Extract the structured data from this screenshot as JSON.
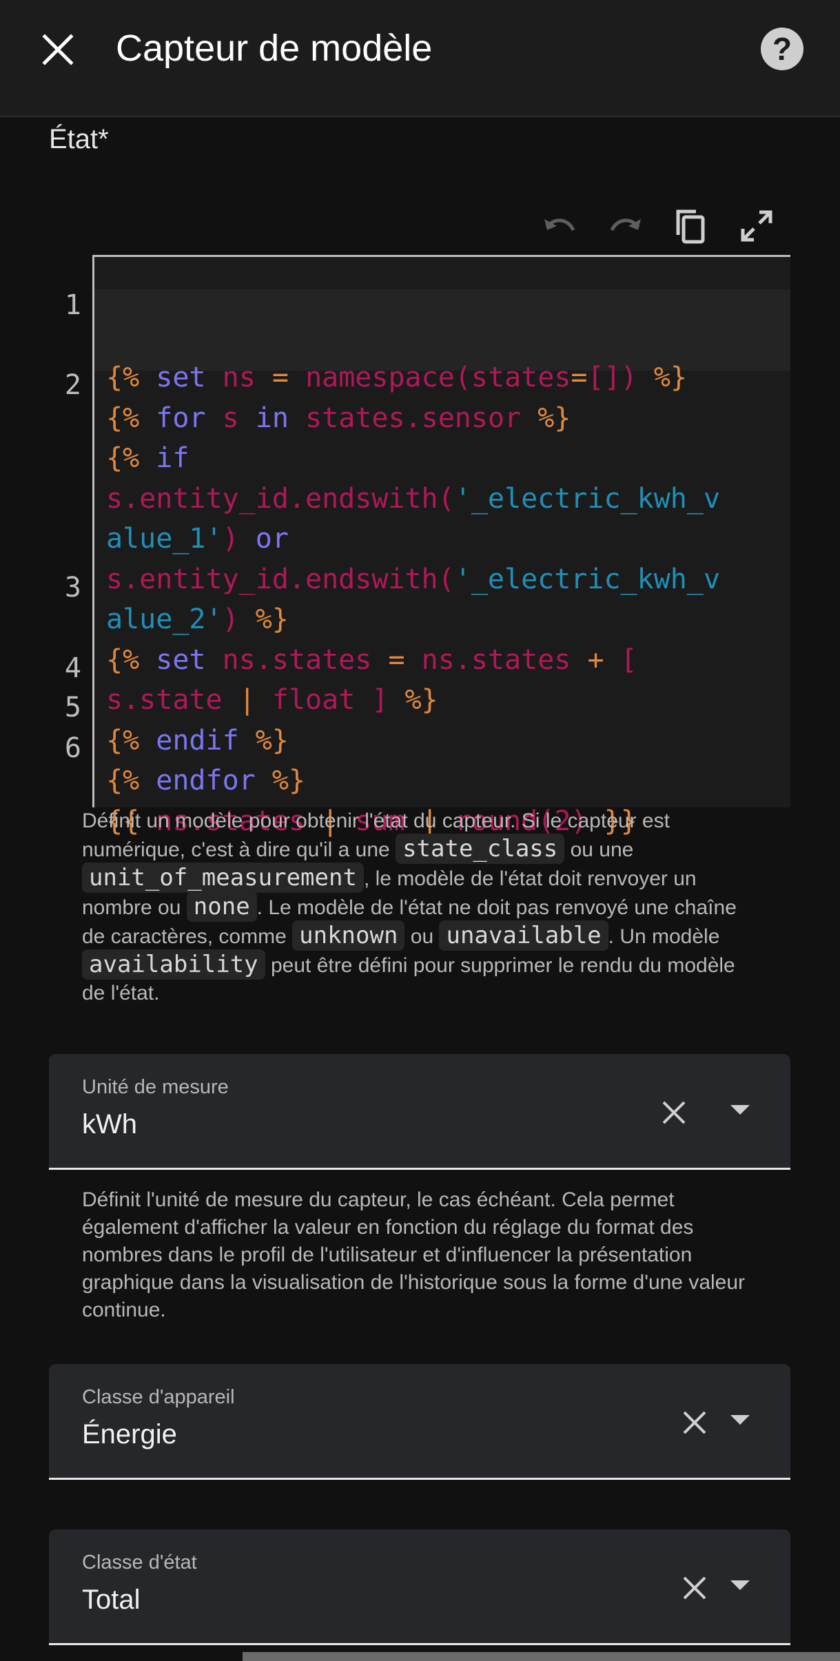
{
  "header": {
    "title": "Capteur de modèle"
  },
  "state_field": {
    "label": "État*"
  },
  "code_editor": {
    "line_numbers": [
      "1",
      "2",
      "3",
      "4",
      "5",
      "6"
    ],
    "lines": [
      "{% set ns = namespace(states=[]) %}",
      "{% for s in states.sensor %}",
      "{% if",
      "s.entity_id.endswith('_electric_kwh_v",
      "alue_1') or",
      "s.entity_id.endswith('_electric_kwh_v",
      "alue_2') %}",
      "{% set ns.states = ns.states + [",
      "s.state | float ] %}",
      "{% endif %}",
      "{% endfor %}",
      "{{ ns.states | sum | round(2) }}"
    ]
  },
  "state_help": {
    "part1": "Définit un modèle pour obtenir l'état du capteur. Si le capteur est numérique, c'est à dire qu'il a une",
    "code1": "state_class",
    "part2": "ou une",
    "code2": "unit_of_measurement",
    "part3": ", le modèle de l'état doit renvoyer un nombre ou",
    "code3": "none",
    "part4": ". Le modèle de l'état ne doit pas renvoyé une chaîne de caractères, comme",
    "code4": "unknown",
    "part5": "ou",
    "code5": "unavailable",
    "part6": ". Un modèle",
    "code6": "availability",
    "part7": "peut être défini pour supprimer le rendu du modèle de l'état."
  },
  "unit_field": {
    "label": "Unité de mesure",
    "value": "kWh",
    "help": "Définit l'unité de mesure du capteur, le cas échéant. Cela permet également d'afficher la valeur en fonction du réglage du format des nombres dans le profil de l'utilisateur et d'influencer la présentation graphique dans la visualisation de l'historique sous la forme d'une valeur continue."
  },
  "device_class_field": {
    "label": "Classe d'appareil",
    "value": "Énergie"
  },
  "state_class_field": {
    "label": "Classe d'état",
    "value": "Total"
  },
  "colors": {
    "background": "#111111",
    "keyword": "#7b76f0",
    "delimiter": "#e0883e",
    "variable": "#b0185a",
    "string": "#1f8fb8"
  }
}
